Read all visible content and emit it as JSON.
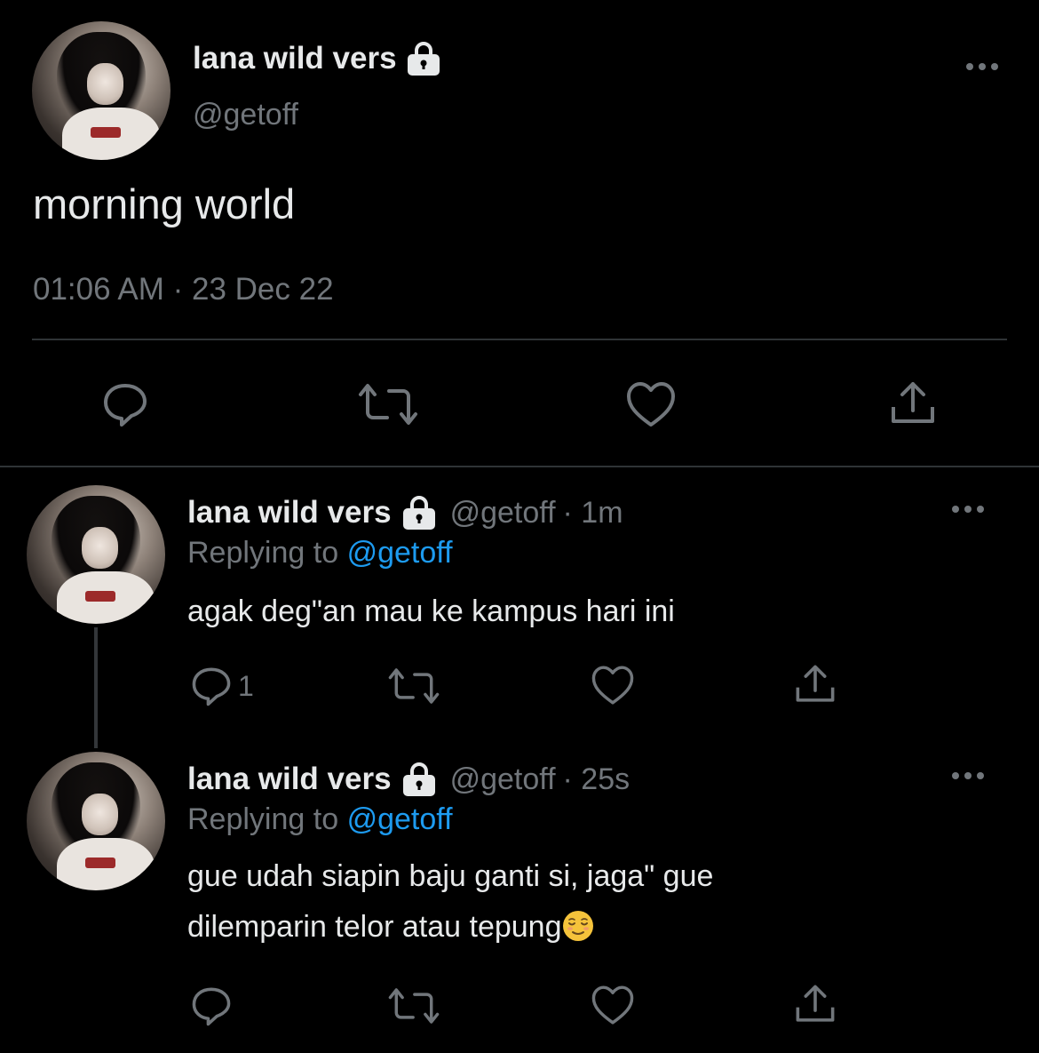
{
  "main_tweet": {
    "display_name": "lana wild vers",
    "handle": "@getoff",
    "text": "morning world",
    "timestamp": "01:06 AM · 23 Dec 22",
    "icons": {
      "lock": "lock-icon",
      "more": "more-icon",
      "reply": "reply-icon",
      "retweet": "retweet-icon",
      "like": "like-icon",
      "share": "share-icon"
    }
  },
  "replies": [
    {
      "display_name": "lana wild vers",
      "handle": "@getoff",
      "time": "· 1m",
      "replying_prefix": "Replying to",
      "replying_handle": "@getoff",
      "text": "agak deg\"an mau ke kampus hari ini",
      "reply_count": "1"
    },
    {
      "display_name": "lana wild vers",
      "handle": "@getoff",
      "time": "· 25s",
      "replying_prefix": "Replying to",
      "replying_handle": "@getoff",
      "text_line1": "gue udah siapin baju ganti si, jaga\" gue",
      "text_line2": "dilemparin telor atau tepung",
      "emoji": "relieved-face-emoji",
      "reply_count": ""
    }
  ],
  "colors": {
    "background": "#000000",
    "text": "#e7e9ea",
    "muted": "#71767b",
    "link": "#1d9bf0",
    "divider": "#2f3336"
  }
}
